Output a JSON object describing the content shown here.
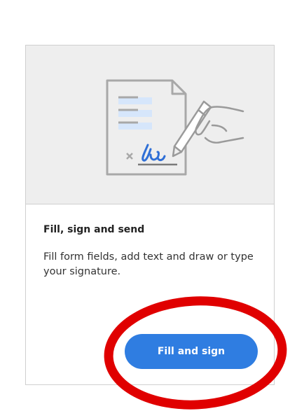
{
  "card": {
    "illustration_icon": "fill-sign-document-icon",
    "title": "Fill, sign and send",
    "description": "Fill form fields, add text and draw or type your signature.",
    "button_label": "Fill and sign"
  },
  "colors": {
    "accent": "#2f7de1",
    "highlight": "#e00000",
    "illustration_bg": "#eeeeee",
    "field_highlight": "#d6e6fb"
  }
}
